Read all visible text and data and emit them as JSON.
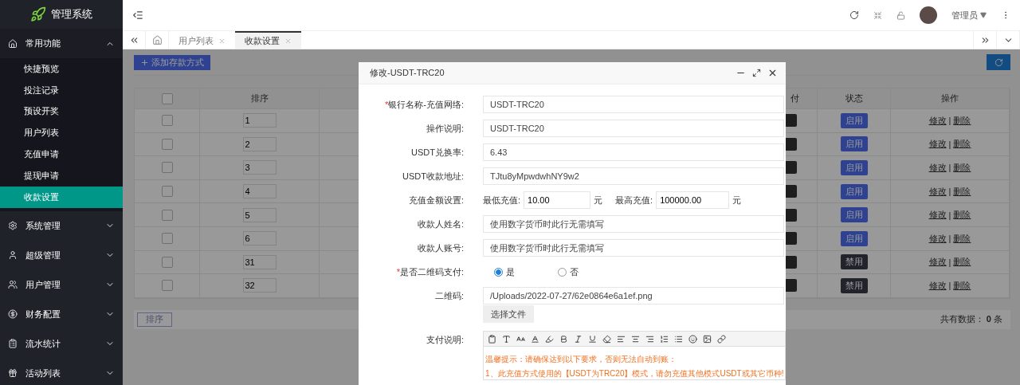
{
  "sidebar": {
    "logo_text": "管理系统",
    "groups": [
      {
        "label": "常用功能",
        "expanded": true,
        "children": [
          {
            "label": "快捷预览",
            "selected": false
          },
          {
            "label": "投注记录",
            "selected": false
          },
          {
            "label": "预设开奖",
            "selected": false
          },
          {
            "label": "用户列表",
            "selected": false
          },
          {
            "label": "充值申请",
            "selected": false
          },
          {
            "label": "提现申请",
            "selected": false
          },
          {
            "label": "收款设置",
            "selected": true
          }
        ]
      },
      {
        "label": "系统管理",
        "expanded": false
      },
      {
        "label": "超级管理",
        "expanded": false
      },
      {
        "label": "用户管理",
        "expanded": false
      },
      {
        "label": "财务配置",
        "expanded": false
      },
      {
        "label": "流水统计",
        "expanded": false
      },
      {
        "label": "活动列表",
        "expanded": false
      }
    ]
  },
  "header": {
    "user_name": "管理员"
  },
  "tabs": [
    {
      "label": "用户列表",
      "selected": false
    },
    {
      "label": "收款设置",
      "selected": true
    }
  ],
  "toolbar": {
    "add_button": "添加存款方式"
  },
  "table": {
    "select_all_checked": false,
    "columns": {
      "order": "排序",
      "column_3": "付",
      "status": "状态",
      "actions": "操作"
    },
    "rows": [
      {
        "checked": false,
        "order": "1",
        "status": "启用",
        "enabled": true,
        "edit": "修改",
        "separator": "|",
        "delete": "删除"
      },
      {
        "checked": false,
        "order": "2",
        "status": "启用",
        "enabled": true,
        "edit": "修改",
        "separator": "|",
        "delete": "删除"
      },
      {
        "checked": false,
        "order": "3",
        "status": "启用",
        "enabled": true,
        "edit": "修改",
        "separator": "|",
        "delete": "删除"
      },
      {
        "checked": false,
        "order": "4",
        "status": "启用",
        "enabled": true,
        "edit": "修改",
        "separator": "|",
        "delete": "删除"
      },
      {
        "checked": false,
        "order": "5",
        "status": "启用",
        "enabled": true,
        "edit": "修改",
        "separator": "|",
        "delete": "删除"
      },
      {
        "checked": false,
        "order": "6",
        "status": "启用",
        "enabled": true,
        "edit": "修改",
        "separator": "|",
        "delete": "删除"
      },
      {
        "checked": false,
        "order": "31",
        "status": "禁用",
        "enabled": false,
        "edit": "修改",
        "separator": "|",
        "delete": "删除"
      },
      {
        "checked": false,
        "order": "32",
        "status": "禁用",
        "enabled": false,
        "edit": "修改",
        "separator": "|",
        "delete": "删除"
      }
    ]
  },
  "footer": {
    "sort_button": "排序",
    "total_label": "共有数据：",
    "total_count": "0",
    "total_unit": "条"
  },
  "modal": {
    "title": "修改-USDT-TRC20",
    "fields": [
      {
        "kind": "text",
        "required_mark": "*",
        "label": "银行名称-充值网络:",
        "value": "USDT-TRC20"
      },
      {
        "kind": "text",
        "label": "操作说明:",
        "value": "USDT-TRC20"
      },
      {
        "kind": "text",
        "label": "USDT兑换率:",
        "value": "6.43"
      },
      {
        "kind": "text",
        "label": "USDT收款地址:",
        "value": "TJtu8yMpwdwhNY9w2"
      },
      {
        "kind": "amount",
        "label": "充值金额设置:",
        "min_label": "最低充值:",
        "min_value": "10.00",
        "min_unit": "元",
        "max_label": "最高充值:",
        "max_value": "100000.00",
        "max_unit": "元"
      },
      {
        "kind": "text",
        "label": "收款人姓名:",
        "value": "使用数字货币时此行无需填写"
      },
      {
        "kind": "text",
        "label": "收款人账号:",
        "value": "使用数字货币时此行无需填写"
      },
      {
        "kind": "radio",
        "required_mark": "*",
        "label": "是否二维码支付:",
        "options": [
          {
            "label": "是",
            "selected": true
          },
          {
            "label": "否",
            "selected": false
          }
        ]
      },
      {
        "kind": "file",
        "label": "二维码:",
        "value": "/Uploads/2022-07-27/62e0864e6a1ef.png",
        "button": "选择文件"
      },
      {
        "kind": "editor",
        "label": "支付说明:",
        "lines": [
          "温馨提示：请确保达到以下要求，否则无法自动到账：",
          "1、此充值方式使用的【USDT为TRC20】模式，请勿充值其他模式USDT或其它币种!"
        ]
      }
    ]
  }
}
